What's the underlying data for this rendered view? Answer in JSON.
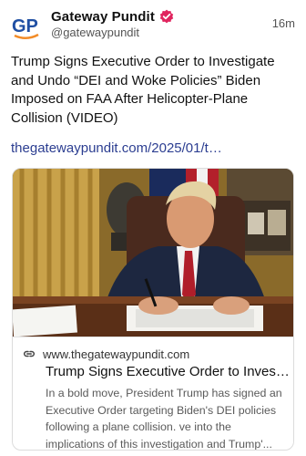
{
  "post": {
    "author": {
      "display_name": "Gateway Pundit",
      "handle": "@gatewaypundit",
      "avatar_text": "GP",
      "verified": true
    },
    "timestamp": "16m",
    "text": "Trump Signs Executive Order to Investigate and Undo “DEI and Woke Policies” Biden Imposed on FAA After Helicopter-Plane Collision (VIDEO)",
    "link_text": "thegatewaypundit.com/2025/01/t…"
  },
  "link_card": {
    "image_alt": "Man in suit signing a document at a desk",
    "domain": "www.thegatewaypundit.com",
    "title": "Trump Signs Executive Order to Investigate and Undo “DEI and Woke Policies”",
    "description": "In a bold move, President Trump has signed an Executive Order targeting Biden's DEI policies following a plane collision. ve into the implications of this investigation and Trump'..."
  },
  "icons": {
    "verified": "verified-badge-icon",
    "link": "link-icon"
  },
  "colors": {
    "link": "#2c3e91",
    "verified": "#e0245e",
    "avatar_blue": "#1f4fa3",
    "avatar_orange": "#f28c28"
  }
}
